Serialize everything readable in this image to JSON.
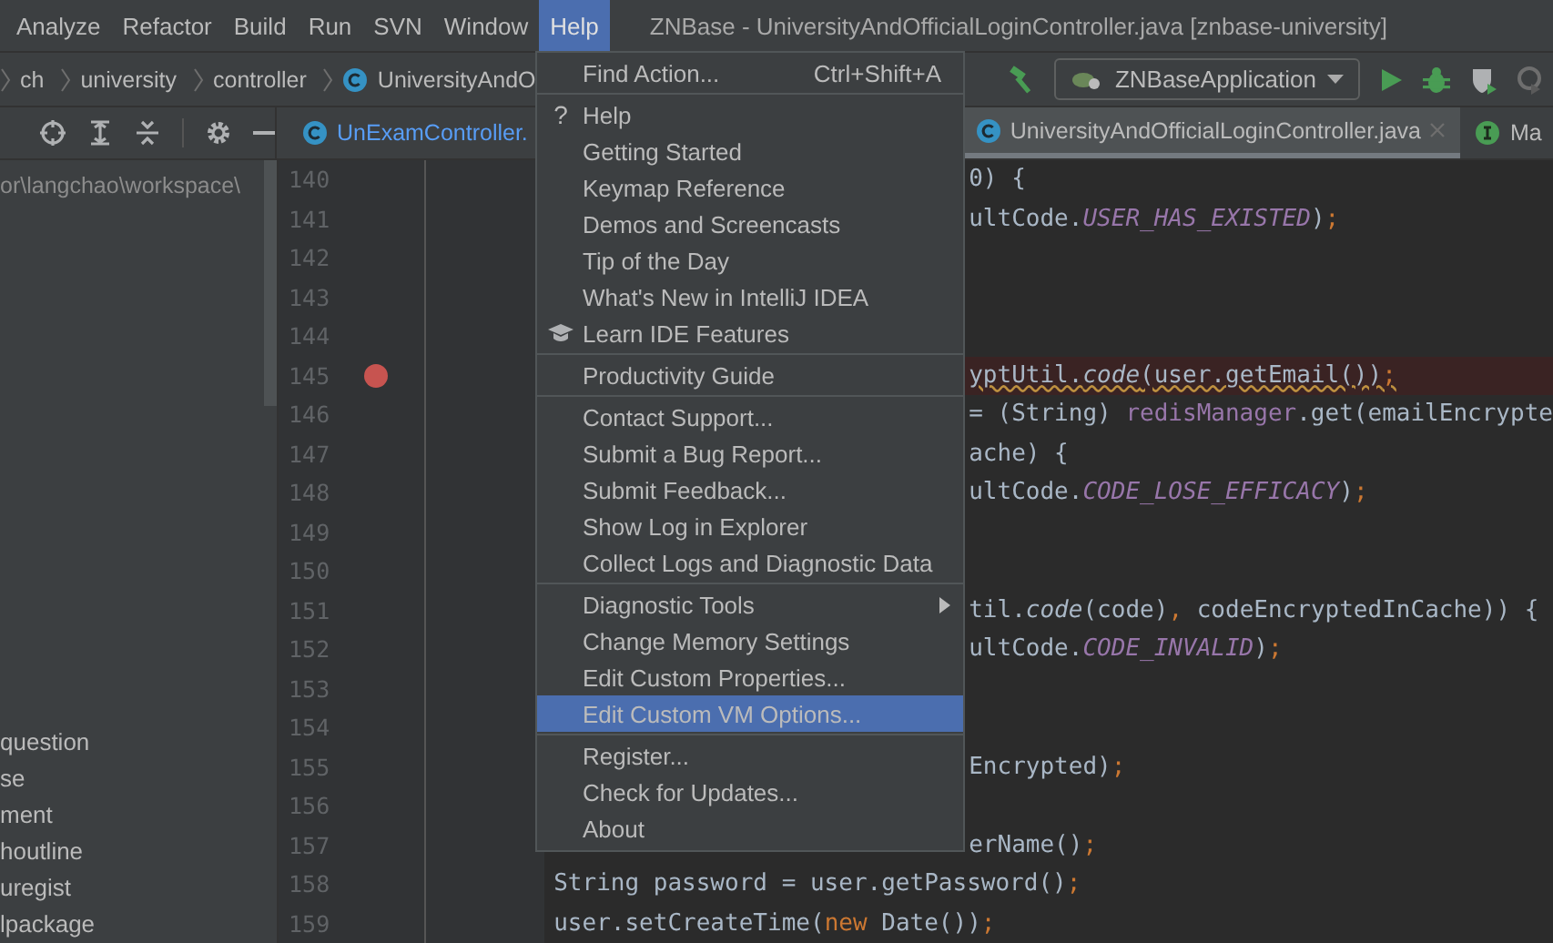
{
  "menubar": [
    {
      "label": "Analyze",
      "selected": false
    },
    {
      "label": "Refactor",
      "selected": false
    },
    {
      "label": "Build",
      "selected": false
    },
    {
      "label": "Run",
      "selected": false
    },
    {
      "label": "SVN",
      "selected": false
    },
    {
      "label": "Window",
      "selected": false
    },
    {
      "label": "Help",
      "selected": true
    }
  ],
  "window": {
    "title": "ZNBase - UniversityAndOfficialLoginController.java [znbase-university]"
  },
  "breadcrumbs": [
    {
      "label": "ch",
      "kind": "folder"
    },
    {
      "label": "university",
      "kind": "folder"
    },
    {
      "label": "controller",
      "kind": "folder"
    },
    {
      "label": "UniversityAndO",
      "kind": "class"
    }
  ],
  "run_config": {
    "label": "ZNBaseApplication"
  },
  "project_panel": {
    "path": "or\\langchao\\workspace\\",
    "items": [
      "question",
      "se",
      "ment",
      "houtline",
      "uregist",
      "lpackage"
    ]
  },
  "tabs": [
    {
      "label": "UnExamController.",
      "kind": "class",
      "selected": false,
      "closable": false
    },
    {
      "label": "UniversityAndOfficialLoginController.java",
      "kind": "class",
      "selected": true,
      "closable": true
    },
    {
      "label": "Ma",
      "kind": "interface",
      "selected": false,
      "closable": false
    }
  ],
  "editor": {
    "rows": [
      {
        "line": "140",
        "kind": "behind_menu",
        "breakpoint": false,
        "tokens": [
          {
            "text": "0) {",
            "kind": "plain"
          }
        ]
      },
      {
        "line": "141",
        "kind": "behind_menu",
        "breakpoint": false,
        "tokens": [
          {
            "text": "ultCode.",
            "kind": "plain"
          },
          {
            "text": "USER_HAS_EXISTED",
            "kind": "const"
          },
          {
            "text": ")",
            "kind": "plain"
          },
          {
            "text": ";",
            "kind": "punct"
          }
        ]
      },
      {
        "line": "142",
        "kind": "behind_menu",
        "breakpoint": false,
        "tokens": []
      },
      {
        "line": "143",
        "kind": "behind_menu",
        "breakpoint": false,
        "tokens": []
      },
      {
        "line": "144",
        "kind": "behind_menu",
        "breakpoint": false,
        "tokens": []
      },
      {
        "line": "145",
        "kind": "behind_menu",
        "breakpoint": true,
        "warning": true,
        "tokens": [
          {
            "text": "yptUtil.",
            "kind": "plain"
          },
          {
            "text": "code",
            "kind": "method"
          },
          {
            "text": "(user.getEmail())",
            "kind": "plain"
          },
          {
            "text": ";",
            "kind": "punct"
          }
        ]
      },
      {
        "line": "146",
        "kind": "behind_menu",
        "breakpoint": false,
        "tokens": [
          {
            "text": "= (String) ",
            "kind": "plain"
          },
          {
            "text": "redisManager",
            "kind": "field"
          },
          {
            "text": ".get(emailEncrypte",
            "kind": "plain"
          }
        ]
      },
      {
        "line": "147",
        "kind": "behind_menu",
        "breakpoint": false,
        "tokens": [
          {
            "text": "ache) {",
            "kind": "plain"
          }
        ]
      },
      {
        "line": "148",
        "kind": "behind_menu",
        "breakpoint": false,
        "tokens": [
          {
            "text": "ultCode.",
            "kind": "plain"
          },
          {
            "text": "CODE_LOSE_EFFICACY",
            "kind": "const"
          },
          {
            "text": ")",
            "kind": "plain"
          },
          {
            "text": ";",
            "kind": "punct"
          }
        ]
      },
      {
        "line": "149",
        "kind": "behind_menu",
        "breakpoint": false,
        "tokens": []
      },
      {
        "line": "150",
        "kind": "behind_menu",
        "breakpoint": false,
        "tokens": []
      },
      {
        "line": "151",
        "kind": "behind_menu",
        "breakpoint": false,
        "tokens": [
          {
            "text": "til.",
            "kind": "plain"
          },
          {
            "text": "code",
            "kind": "method"
          },
          {
            "text": "(code)",
            "kind": "plain"
          },
          {
            "text": ",",
            "kind": "punct"
          },
          {
            "text": " codeEncryptedInCache)) {",
            "kind": "plain"
          }
        ]
      },
      {
        "line": "152",
        "kind": "behind_menu",
        "breakpoint": false,
        "tokens": [
          {
            "text": "ultCode.",
            "kind": "plain"
          },
          {
            "text": "CODE_INVALID",
            "kind": "const"
          },
          {
            "text": ")",
            "kind": "plain"
          },
          {
            "text": ";",
            "kind": "punct"
          }
        ]
      },
      {
        "line": "153",
        "kind": "behind_menu",
        "breakpoint": false,
        "tokens": []
      },
      {
        "line": "154",
        "kind": "behind_menu",
        "breakpoint": false,
        "tokens": []
      },
      {
        "line": "155",
        "kind": "behind_menu",
        "breakpoint": false,
        "tokens": [
          {
            "text": "Encrypted)",
            "kind": "plain"
          },
          {
            "text": ";",
            "kind": "punct"
          }
        ]
      },
      {
        "line": "156",
        "kind": "behind_menu",
        "breakpoint": false,
        "tokens": []
      },
      {
        "line": "157",
        "kind": "behind_menu",
        "breakpoint": false,
        "tokens": [
          {
            "text": "erName()",
            "kind": "plain"
          },
          {
            "text": ";",
            "kind": "punct"
          }
        ]
      },
      {
        "line": "158",
        "kind": "full",
        "breakpoint": false,
        "tokens": [
          {
            "text": "String password = user.getPassword()",
            "kind": "plain"
          },
          {
            "text": ";",
            "kind": "punct"
          }
        ]
      },
      {
        "line": "159",
        "kind": "full",
        "breakpoint": false,
        "tokens": [
          {
            "text": "user.setCreateTime(",
            "kind": "plain"
          },
          {
            "text": "new",
            "kind": "keyword"
          },
          {
            "text": " Date())",
            "kind": "plain"
          },
          {
            "text": ";",
            "kind": "punct"
          }
        ]
      }
    ]
  },
  "help_menu": {
    "items": [
      {
        "kind": "item",
        "label": "Find Action...",
        "shortcut": "Ctrl+Shift+A",
        "selected": false
      },
      {
        "kind": "separator"
      },
      {
        "kind": "item",
        "label": "Help",
        "glyph": "?",
        "selected": false
      },
      {
        "kind": "item",
        "label": "Getting Started",
        "selected": false
      },
      {
        "kind": "item",
        "label": "Keymap Reference",
        "selected": false
      },
      {
        "kind": "item",
        "label": "Demos and Screencasts",
        "selected": false
      },
      {
        "kind": "item",
        "label": "Tip of the Day",
        "selected": false
      },
      {
        "kind": "item",
        "label": "What's New in IntelliJ IDEA",
        "selected": false
      },
      {
        "kind": "learn",
        "label": "Learn IDE Features",
        "selected": false
      },
      {
        "kind": "separator"
      },
      {
        "kind": "item",
        "label": "Productivity Guide",
        "selected": false
      },
      {
        "kind": "separator"
      },
      {
        "kind": "item",
        "label": "Contact Support...",
        "selected": false
      },
      {
        "kind": "item",
        "label": "Submit a Bug Report...",
        "selected": false
      },
      {
        "kind": "item",
        "label": "Submit Feedback...",
        "selected": false
      },
      {
        "kind": "item",
        "label": "Show Log in Explorer",
        "selected": false
      },
      {
        "kind": "item",
        "label": "Collect Logs and Diagnostic Data",
        "selected": false
      },
      {
        "kind": "separator"
      },
      {
        "kind": "item",
        "label": "Diagnostic Tools",
        "submenu": true,
        "selected": false
      },
      {
        "kind": "item",
        "label": "Change Memory Settings",
        "selected": false
      },
      {
        "kind": "item",
        "label": "Edit Custom Properties...",
        "selected": false
      },
      {
        "kind": "item",
        "label": "Edit Custom VM Options...",
        "selected": true
      },
      {
        "kind": "separator"
      },
      {
        "kind": "item",
        "label": "Register...",
        "selected": false
      },
      {
        "kind": "item",
        "label": "Check for Updates...",
        "selected": false
      },
      {
        "kind": "item",
        "label": "About",
        "selected": false
      }
    ]
  }
}
